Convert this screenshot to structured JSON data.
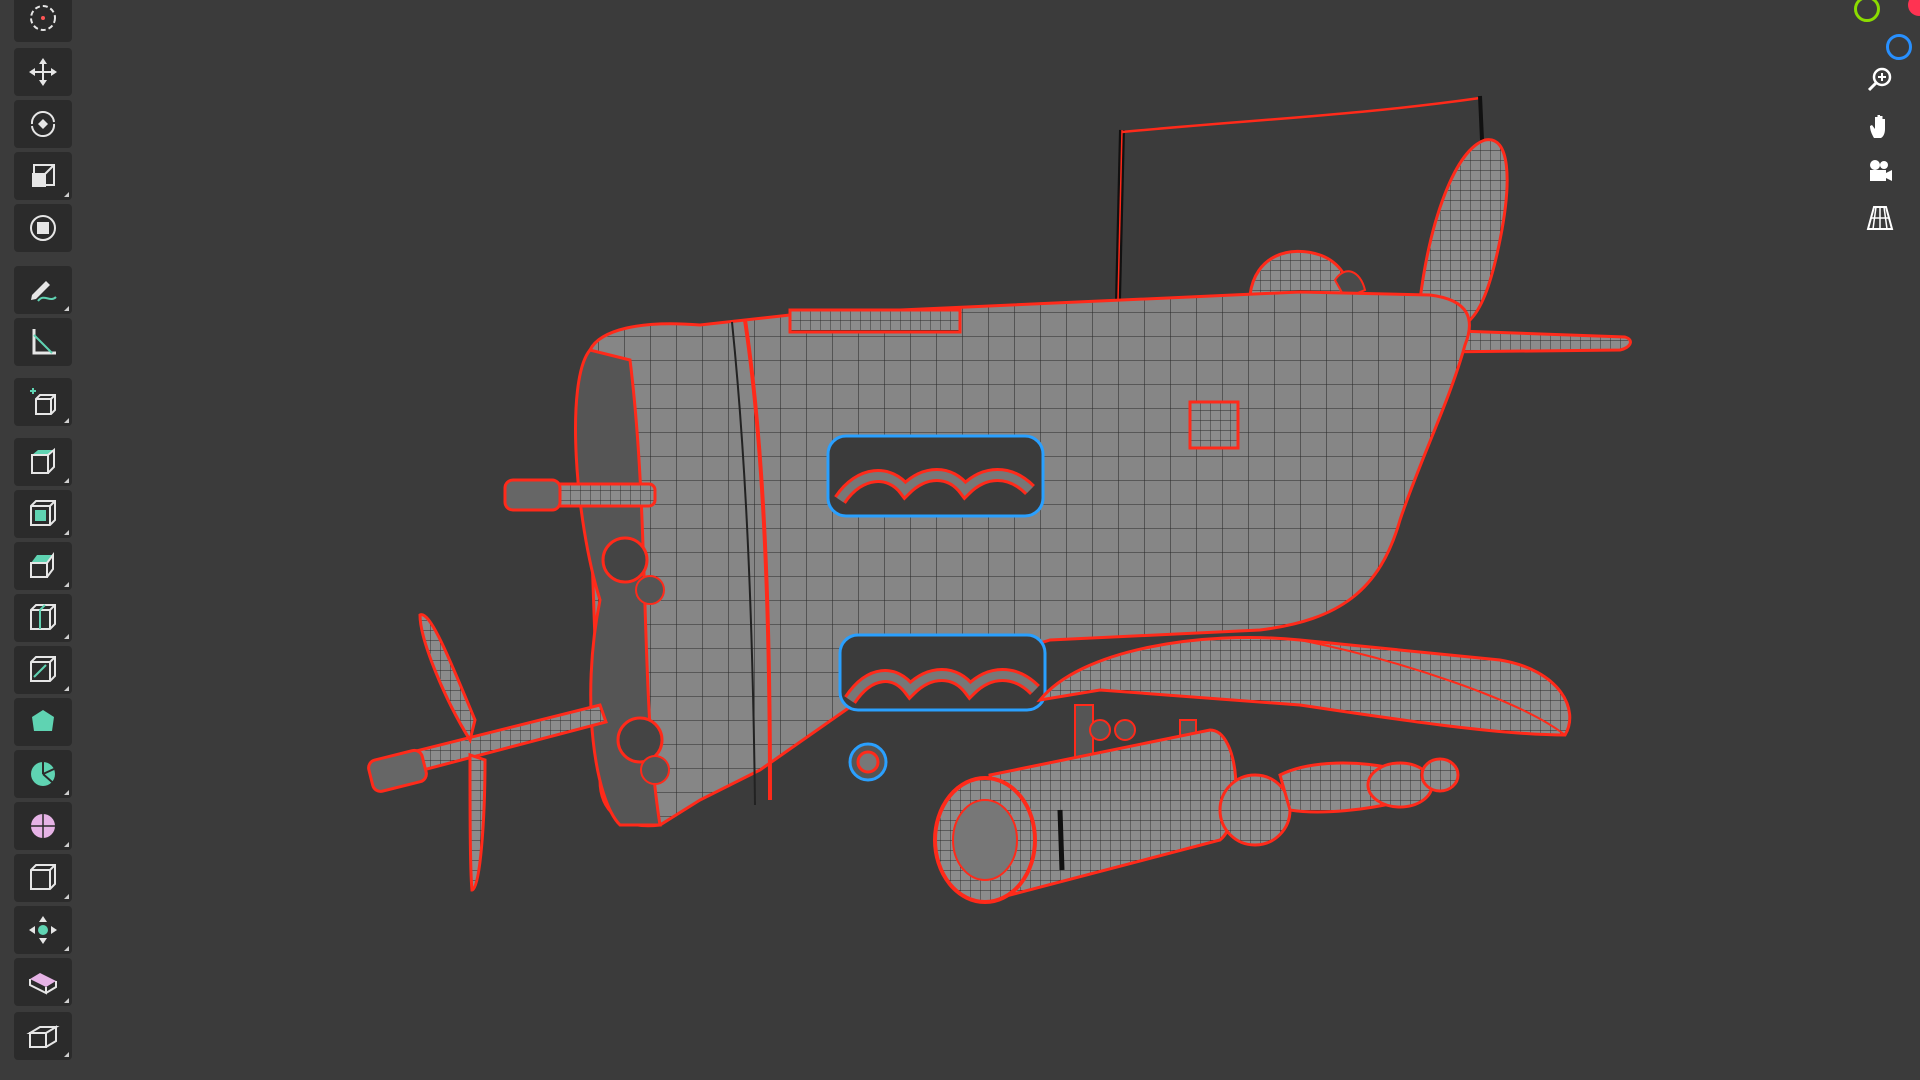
{
  "viewport": {
    "background": "#3b3b3b",
    "wire_color": "#ff2a1a",
    "mesh_fill": "#8a8a8a",
    "seam_color": "#2aa0ff"
  },
  "toolbar": {
    "tools": [
      {
        "name": "cursor-tool",
        "icon": "cursor-icon"
      },
      {
        "name": "move-tool",
        "icon": "move-icon"
      },
      {
        "name": "rotate-tool",
        "icon": "rotate-icon"
      },
      {
        "name": "scale-tool",
        "icon": "scale-icon"
      },
      {
        "name": "transform-tool",
        "icon": "transform-icon"
      },
      {
        "name": "annotate-tool",
        "icon": "annotate-icon"
      },
      {
        "name": "measure-tool",
        "icon": "measure-icon"
      },
      {
        "name": "add-cube-tool",
        "icon": "add-cube-icon"
      },
      {
        "name": "extrude-tool",
        "icon": "extrude-icon"
      },
      {
        "name": "inset-tool",
        "icon": "inset-icon"
      },
      {
        "name": "bevel-tool",
        "icon": "bevel-icon"
      },
      {
        "name": "loop-cut-tool",
        "icon": "loop-cut-icon"
      },
      {
        "name": "knife-tool",
        "icon": "knife-icon"
      },
      {
        "name": "poly-build-tool",
        "icon": "poly-build-icon"
      },
      {
        "name": "spin-tool",
        "icon": "spin-icon"
      },
      {
        "name": "smooth-tool",
        "icon": "smooth-icon"
      },
      {
        "name": "edge-slide-tool",
        "icon": "edge-slide-icon"
      },
      {
        "name": "shrink-fatten-tool",
        "icon": "shrink-fatten-icon"
      },
      {
        "name": "shear-tool",
        "icon": "shear-icon"
      },
      {
        "name": "rip-region-tool",
        "icon": "rip-region-icon"
      }
    ]
  },
  "navigation": {
    "gizmo_colors": {
      "x": "#ff3352",
      "y": "#8bdc00",
      "z": "#2890ff"
    },
    "buttons": [
      {
        "name": "zoom-button",
        "icon": "zoom-icon"
      },
      {
        "name": "pan-button",
        "icon": "hand-icon"
      },
      {
        "name": "camera-button",
        "icon": "camera-icon"
      },
      {
        "name": "perspective-button",
        "icon": "grid-icon"
      }
    ]
  }
}
